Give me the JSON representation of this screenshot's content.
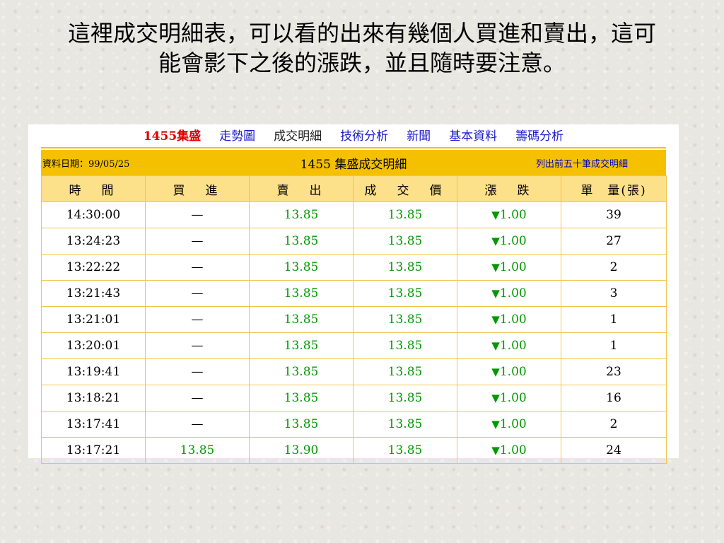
{
  "slide": {
    "title_line1": "這裡成交明細表，可以看的出來有幾個人買進和賣出，這可",
    "title_line2": "能會影下之後的漲跌，並且隨時要注意。"
  },
  "nav": {
    "brand": "1455集盛",
    "items": [
      "走勢圖",
      "成交明細",
      "技術分析",
      "新聞",
      "基本資料",
      "籌碼分析"
    ],
    "current": "成交明細"
  },
  "table": {
    "date_label": "資料日期：99/05/25",
    "title": "1455 集盛成交明細",
    "note": "列出前五十筆成交明細",
    "headers": [
      "時　間",
      "買　進",
      "賣　出",
      "成　交　價",
      "漲　跌",
      "單　量(張)"
    ],
    "down_icon": "down-triangle-icon",
    "rows": [
      {
        "time": "14:30:00",
        "buy": "—",
        "sell": "13.85",
        "price": "13.85",
        "change": "1.00",
        "qty": "39"
      },
      {
        "time": "13:24:23",
        "buy": "—",
        "sell": "13.85",
        "price": "13.85",
        "change": "1.00",
        "qty": "27"
      },
      {
        "time": "13:22:22",
        "buy": "—",
        "sell": "13.85",
        "price": "13.85",
        "change": "1.00",
        "qty": "2"
      },
      {
        "time": "13:21:43",
        "buy": "—",
        "sell": "13.85",
        "price": "13.85",
        "change": "1.00",
        "qty": "3"
      },
      {
        "time": "13:21:01",
        "buy": "—",
        "sell": "13.85",
        "price": "13.85",
        "change": "1.00",
        "qty": "1"
      },
      {
        "time": "13:20:01",
        "buy": "—",
        "sell": "13.85",
        "price": "13.85",
        "change": "1.00",
        "qty": "1"
      },
      {
        "time": "13:19:41",
        "buy": "—",
        "sell": "13.85",
        "price": "13.85",
        "change": "1.00",
        "qty": "23"
      },
      {
        "time": "13:18:21",
        "buy": "—",
        "sell": "13.85",
        "price": "13.85",
        "change": "1.00",
        "qty": "16"
      },
      {
        "time": "13:17:41",
        "buy": "—",
        "sell": "13.85",
        "price": "13.85",
        "change": "1.00",
        "qty": "2"
      },
      {
        "time": "13:17:21",
        "buy": "13.85",
        "sell": "13.90",
        "price": "13.85",
        "change": "1.00",
        "qty": "24"
      }
    ]
  },
  "colors": {
    "header_bar": "#f5c000",
    "column_header": "#fde08a",
    "border": "#f2c44a",
    "price_green": "#009900",
    "brand_red": "#e00000",
    "link_blue": "#1a1acc"
  }
}
